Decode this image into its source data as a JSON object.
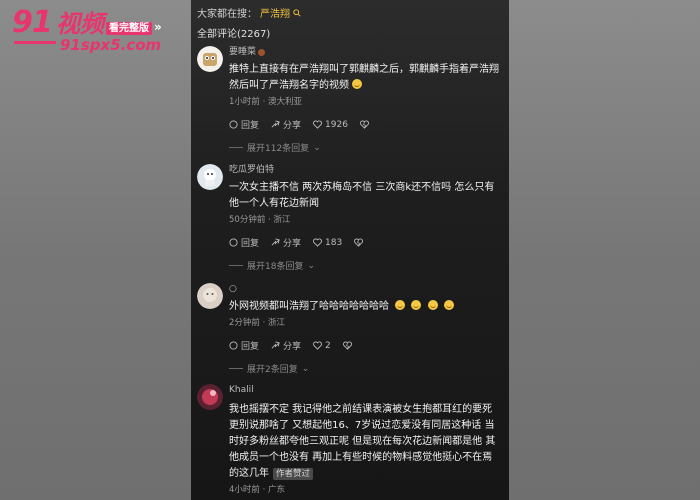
{
  "watermark": {
    "brand": "91",
    "brand_cn": "视频",
    "tag": "看完整版",
    "chevrons": "»",
    "url": "91spx5.com"
  },
  "header": {
    "search_prefix": "大家都在搜：",
    "search_term": "严浩翔",
    "comment_count_label": "全部评论(2267)"
  },
  "comments": [
    {
      "username": "要睡菜",
      "text": "推特上直接有在严浩翔叫了郭麒麟之后，郭麒麟手指着严浩翔然后叫了严浩翔名字的视频",
      "meta": "1小时前 · 澳大利亚",
      "reply_label": "回复",
      "share_label": "分享",
      "likes": "1926",
      "expand_label": "展开112条回复"
    },
    {
      "username": "吃瓜罗伯特",
      "text": "一次女主播不信 两次苏梅岛不信 三次商k还不信吗 怎么只有他一个人有花边新闻",
      "meta": "50分钟前 · 浙江",
      "reply_label": "回复",
      "share_label": "分享",
      "likes": "183",
      "expand_label": "展开18条回复"
    },
    {
      "username": "○",
      "text": "外网视频都叫浩翔了哈哈哈哈哈哈哈",
      "meta": "2分钟前 · 浙江",
      "reply_label": "回复",
      "share_label": "分享",
      "likes": "2",
      "expand_label": "展开2条回复"
    },
    {
      "username": "Khalil",
      "text": "我也摇摆不定 我记得他之前结课表演被女生抱都耳红的要死更别说那啥了 又想起他16、7岁说过恋爱没有同居这种话 当时好多粉丝都夸他三观正呢 但是现在每次花边新闻都是他 其他成员一个也没有 再加上有些时候的物料感觉他挺心不在焉的这几年",
      "author_badge": "作者赞过",
      "meta": "4小时前 · 广东"
    }
  ]
}
